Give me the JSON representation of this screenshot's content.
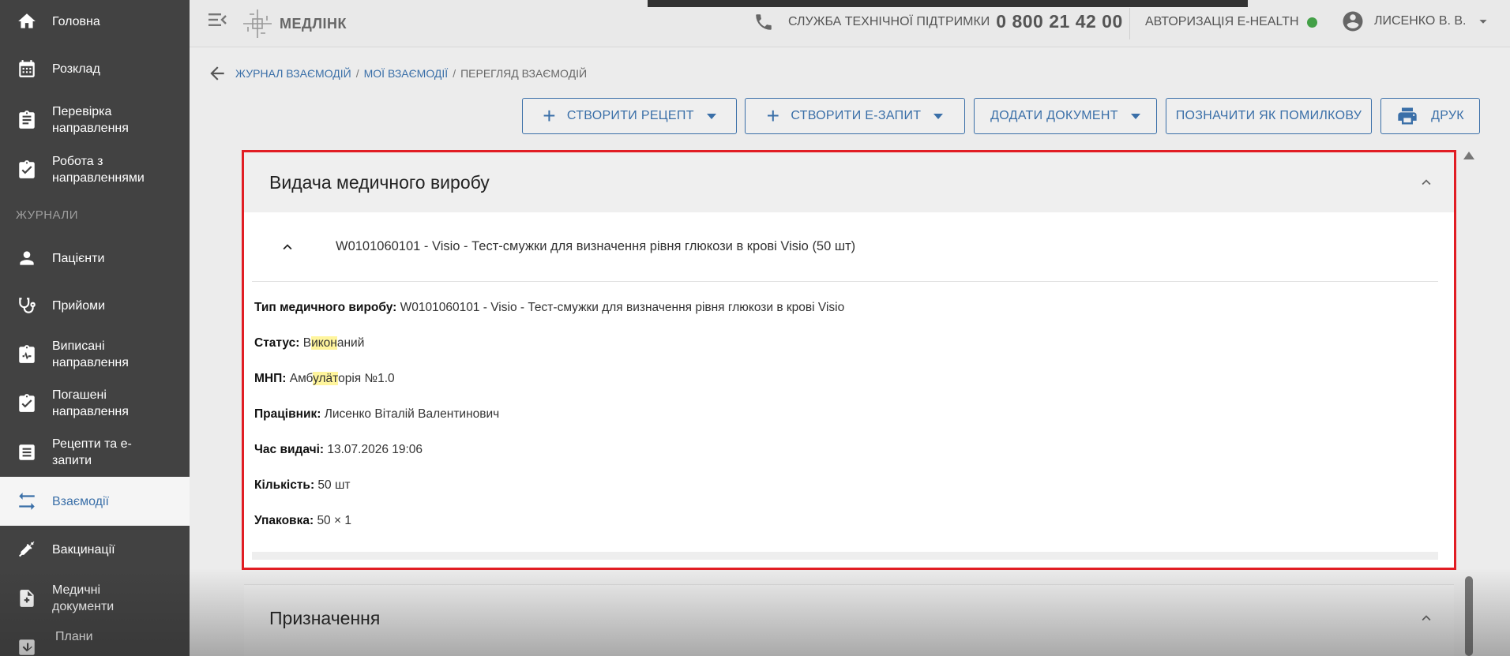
{
  "sidebar": {
    "items": [
      {
        "label": "Головна",
        "icon": "home-icon"
      },
      {
        "label": "Розклад",
        "icon": "calendar-icon"
      },
      {
        "label": "Перевірка направлення",
        "icon": "clipboard-list-icon"
      },
      {
        "label": "Робота з направленнями",
        "icon": "clipboard-check-icon"
      }
    ],
    "section_label": "ЖУРНАЛИ",
    "journal_items": [
      {
        "label": "Пацієнти",
        "icon": "person-icon"
      },
      {
        "label": "Прийоми",
        "icon": "stethoscope-icon"
      },
      {
        "label": "Виписані направлення",
        "icon": "clipboard-pulse-icon"
      },
      {
        "label": "Погашені направлення",
        "icon": "clipboard-done-icon"
      },
      {
        "label": "Рецепти та е-запити",
        "icon": "list-box-icon"
      },
      {
        "label": "Взаємодії",
        "icon": "swap-arrows-icon",
        "active": true
      },
      {
        "label": "Вакцинації",
        "icon": "syringe-icon"
      },
      {
        "label": "Медичні документи",
        "icon": "medical-file-icon"
      },
      {
        "label": "Плани",
        "icon": "plan-icon"
      }
    ]
  },
  "header": {
    "logo_text": "МЕДЛІНК",
    "support_label": "СЛУЖБА ТЕХНІЧНОЇ ПІДТРИМКИ",
    "support_phone": "0 800 21 42 00",
    "auth_label": "АВТОРИЗАЦІЯ E-HEALTH",
    "auth_status_color": "#43a047",
    "user_name": "ЛИСЕНКО В. В."
  },
  "breadcrumb": {
    "items": [
      "ЖУРНАЛ ВЗАЄМОДІЙ",
      "МОЇ ВЗАЄМОДІЇ"
    ],
    "current": "ПЕРЕГЛЯД ВЗАЄМОДІЙ",
    "separator": "/"
  },
  "actions": {
    "create_recipe": "СТВОРИТИ РЕЦЕПТ",
    "create_request": "СТВОРИТИ Е-ЗАПИТ",
    "add_document": "ДОДАТИ ДОКУМЕНТ",
    "mark_error": "ПОЗНАЧИТИ ЯК ПОМИЛКОВУ",
    "print": "ДРУК"
  },
  "panel": {
    "title": "Видача медичного виробу",
    "item_title": "W0101060101 - Visio - Тест-смужки для визначення рівня глюкози в крові Visio (50 шт)",
    "details": {
      "type_label": "Тип медичного виробу:",
      "type_value": "W0101060101 - Visio - Тест-смужки для визначення рівня глюкози в крові Visio",
      "status_label": "Статус:",
      "status_pre": "В",
      "status_hl": "икон",
      "status_post": "аний",
      "mnp_label": "МНП:",
      "mnp_pre": "Амб",
      "mnp_hl": "улӓт",
      "mnp_post": "орія №1.0",
      "worker_label": "Працівник:",
      "worker_value": "Лисенко Віталій Валентинович",
      "time_label": "Час видачі:",
      "time_value": "13.07.2026 19:06",
      "qty_label": "Кількість:",
      "qty_value": "50 шт",
      "pack_label": "Упаковка:",
      "pack_value": "50 × 1"
    }
  },
  "panel2": {
    "title": "Призначення"
  },
  "colors": {
    "accent": "#3a6fa8",
    "sidebar_bg": "#424242",
    "highlight_border": "#e11d24"
  }
}
